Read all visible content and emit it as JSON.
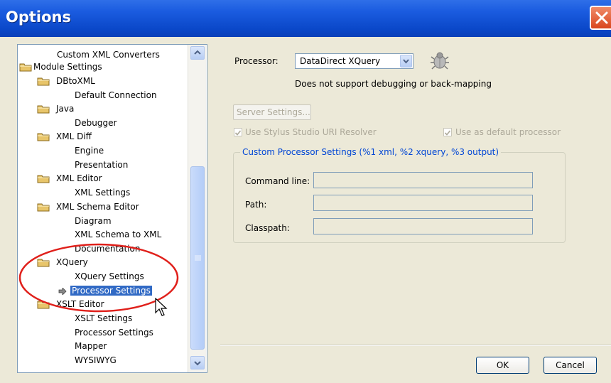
{
  "window": {
    "title": "Options"
  },
  "tree": {
    "items": [
      {
        "label": "Custom XML Converters"
      },
      {
        "label": "Module Settings"
      },
      {
        "label": "DBtoXML"
      },
      {
        "label": "Default Connection"
      },
      {
        "label": "Java"
      },
      {
        "label": "Debugger"
      },
      {
        "label": "XML Diff"
      },
      {
        "label": "Engine"
      },
      {
        "label": "Presentation"
      },
      {
        "label": "XML Editor"
      },
      {
        "label": "XML Settings"
      },
      {
        "label": "XML Schema Editor"
      },
      {
        "label": "Diagram"
      },
      {
        "label": "XML Schema to XML"
      },
      {
        "label": "Documentation"
      },
      {
        "label": "XQuery"
      },
      {
        "label": "XQuery Settings"
      },
      {
        "label": "Processor Settings"
      },
      {
        "label": "XSLT Editor"
      },
      {
        "label": "XSLT Settings"
      },
      {
        "label": "Processor Settings"
      },
      {
        "label": "Mapper"
      },
      {
        "label": "WYSIWYG"
      }
    ],
    "selected_label": "Processor Settings"
  },
  "processor": {
    "label": "Processor:",
    "selected": "DataDirect XQuery",
    "note": "Does not support debugging or back-mapping"
  },
  "server_settings_label": "Server Settings...",
  "checkboxes": {
    "uri_resolver": "Use Stylus Studio URI Resolver",
    "default_processor": "Use as default processor"
  },
  "custom_group": {
    "title": "Custom Processor Settings (%1 xml, %2 xquery, %3 output)",
    "command_line_label": "Command line:",
    "path_label": "Path:",
    "classpath_label": "Classpath:"
  },
  "buttons": {
    "ok": "OK",
    "cancel": "Cancel"
  },
  "colors": {
    "title_bar": "#0a47c8",
    "selection": "#316ac5",
    "annotation_circle": "#e0201b",
    "group_title": "#0046d5"
  }
}
